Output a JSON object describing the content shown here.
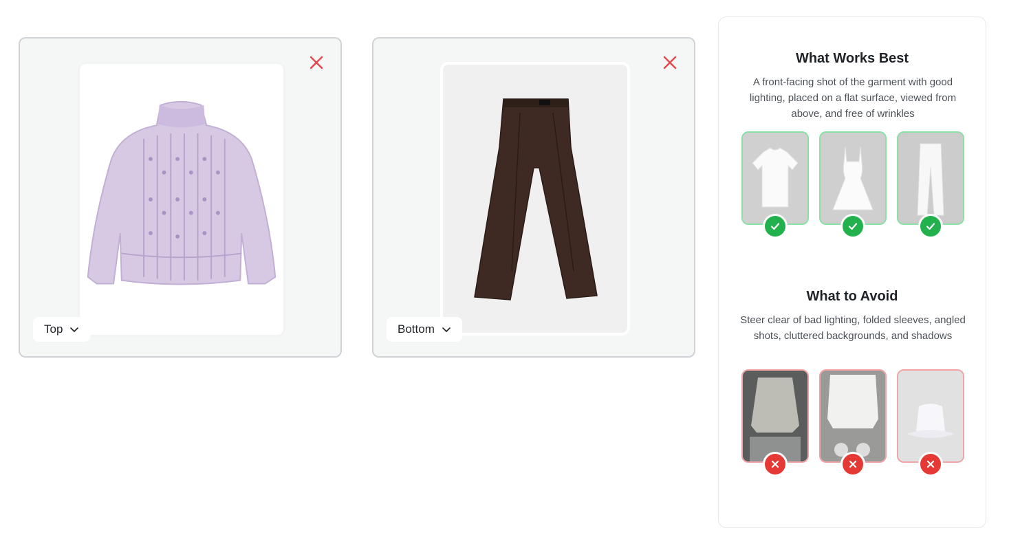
{
  "uploads": [
    {
      "category": "Top",
      "garment": "lavender cable-knit sweater"
    },
    {
      "category": "Bottom",
      "garment": "brown wide-leg trousers"
    }
  ],
  "guide": {
    "good": {
      "title": "What Works Best",
      "description": "A front-facing shot of the garment with good lighting, placed on a flat surface, viewed from above, and free of wrinkles",
      "examples": [
        "white t-shirt",
        "white dress",
        "white trousers"
      ]
    },
    "bad": {
      "title": "What to Avoid",
      "description": "Steer clear of bad lighting, folded sleeves, angled shots, cluttered backgrounds, and shadows",
      "examples": [
        "grey sweater dim lighting",
        "white sweater cluttered background",
        "white bucket hat with shadows"
      ]
    }
  },
  "colors": {
    "accent_ok": "#22b14c",
    "accent_error": "#e53935",
    "close_icon": "#e5484d"
  },
  "icons": [
    "close-icon",
    "chevron-down-icon",
    "check-icon",
    "x-icon"
  ]
}
